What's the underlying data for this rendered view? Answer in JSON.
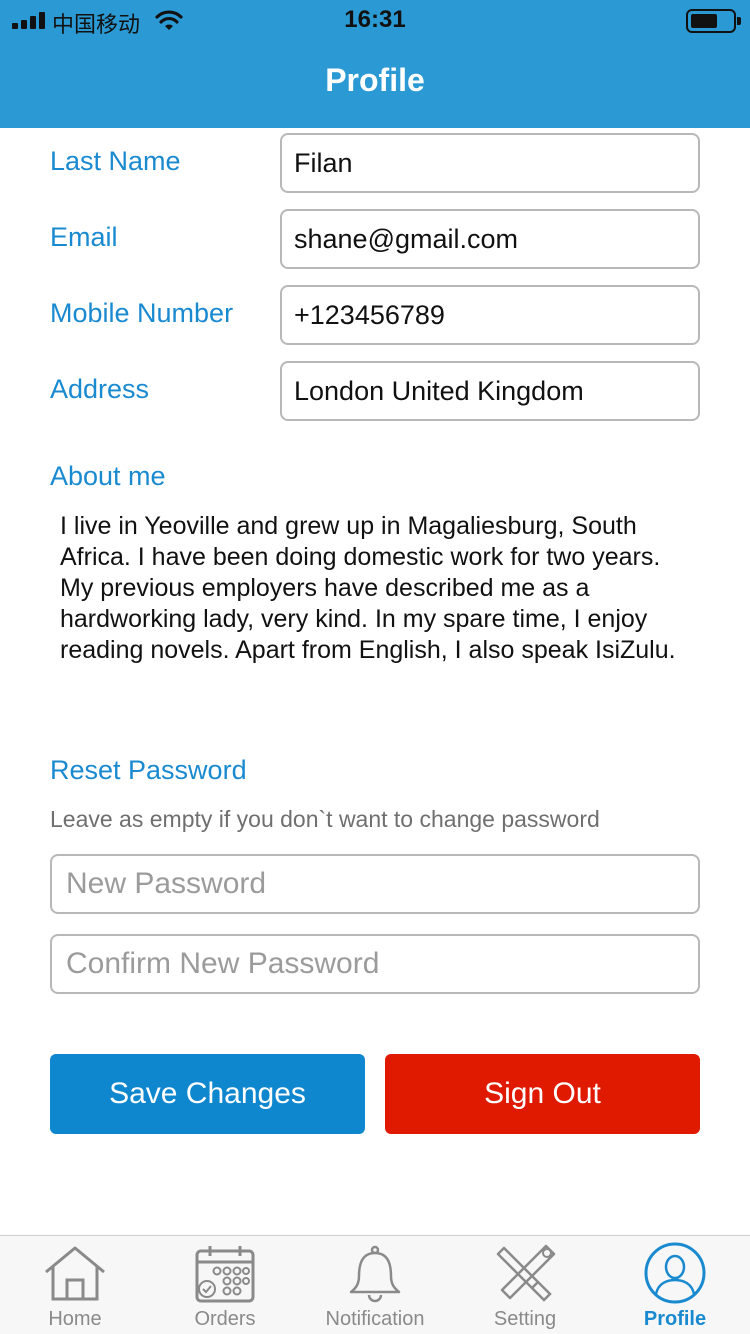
{
  "status_bar": {
    "carrier": "中国移动",
    "time": "16:31"
  },
  "header": {
    "title": "Profile"
  },
  "form": {
    "last_name": {
      "label": "Last Name",
      "value": "Filan"
    },
    "email": {
      "label": "Email",
      "value": "shane@gmail.com"
    },
    "mobile": {
      "label": "Mobile Number",
      "value": "+123456789"
    },
    "address": {
      "label": "Address",
      "value": "London United Kingdom"
    }
  },
  "about": {
    "label": "About me",
    "text": "I live in Yeoville and grew up in Magaliesburg, South Africa. I have been doing domestic work for two years. My previous employers have described me as a hardworking lady, very kind. In my spare time, I enjoy reading novels. Apart from English, I also speak IsiZulu."
  },
  "reset": {
    "label": "Reset Password",
    "hint": "Leave as empty if you don`t want to change password",
    "new_placeholder": "New Password",
    "confirm_placeholder": "Confirm New Password"
  },
  "actions": {
    "save_label": "Save Changes",
    "signout_label": "Sign Out"
  },
  "colors": {
    "accent": "#2b9ad4",
    "label": "#1a8ad0",
    "danger": "#e01a00",
    "save": "#0f87cf"
  },
  "tabbar": {
    "items": [
      {
        "label": "Home",
        "icon": "home-icon",
        "active": false
      },
      {
        "label": "Orders",
        "icon": "calendar-icon",
        "active": false
      },
      {
        "label": "Notification",
        "icon": "bell-icon",
        "active": false
      },
      {
        "label": "Setting",
        "icon": "tools-icon",
        "active": false
      },
      {
        "label": "Profile",
        "icon": "user-icon",
        "active": true
      }
    ]
  }
}
